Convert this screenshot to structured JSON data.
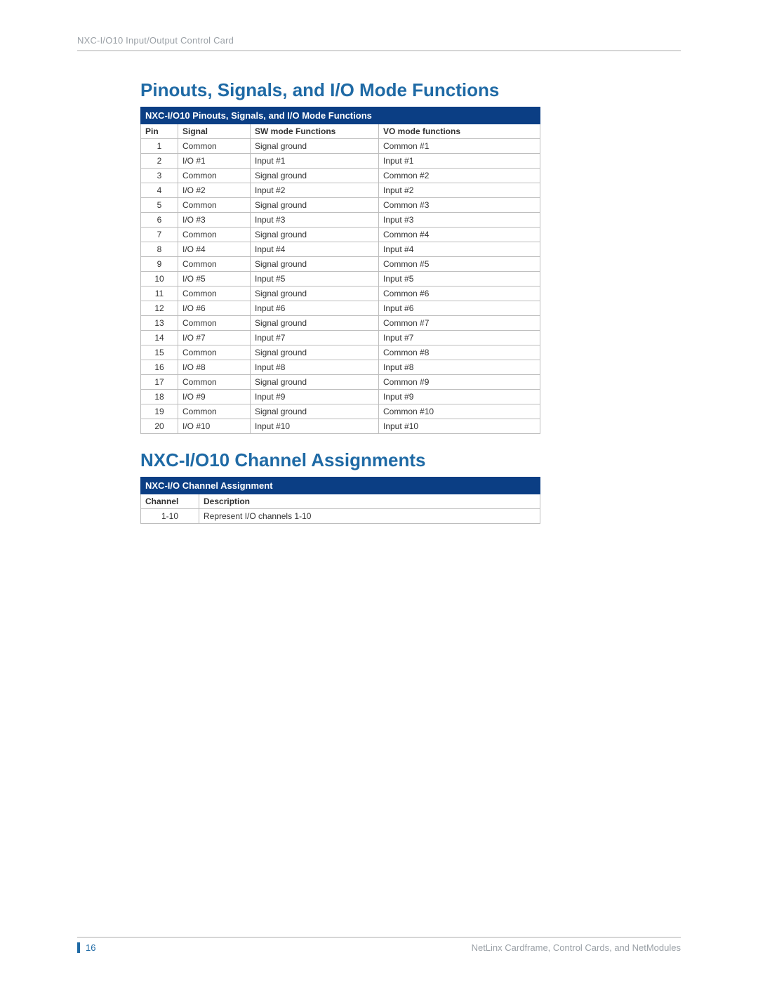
{
  "header": {
    "text": "NXC-I/O10 Input/Output Control Card"
  },
  "section1": {
    "title": "Pinouts, Signals, and I/O Mode Functions",
    "table_title": "NXC-I/O10 Pinouts, Signals, and I/O Mode Functions",
    "columns": {
      "c1": "Pin",
      "c2": "Signal",
      "c3": "SW mode Functions",
      "c4": "VO mode functions"
    },
    "rows": [
      {
        "pin": "1",
        "signal": "Common",
        "sw": "Signal ground",
        "vo": "Common #1"
      },
      {
        "pin": "2",
        "signal": "I/O #1",
        "sw": "Input #1",
        "vo": "Input #1"
      },
      {
        "pin": "3",
        "signal": "Common",
        "sw": "Signal ground",
        "vo": "Common #2"
      },
      {
        "pin": "4",
        "signal": "I/O #2",
        "sw": "Input #2",
        "vo": "Input #2"
      },
      {
        "pin": "5",
        "signal": "Common",
        "sw": "Signal ground",
        "vo": "Common #3"
      },
      {
        "pin": "6",
        "signal": "I/O #3",
        "sw": "Input #3",
        "vo": "Input #3"
      },
      {
        "pin": "7",
        "signal": "Common",
        "sw": "Signal ground",
        "vo": "Common #4"
      },
      {
        "pin": "8",
        "signal": "I/O #4",
        "sw": "Input #4",
        "vo": "Input #4"
      },
      {
        "pin": "9",
        "signal": "Common",
        "sw": "Signal ground",
        "vo": "Common #5"
      },
      {
        "pin": "10",
        "signal": "I/O #5",
        "sw": "Input #5",
        "vo": "Input #5"
      },
      {
        "pin": "11",
        "signal": "Common",
        "sw": "Signal ground",
        "vo": "Common #6"
      },
      {
        "pin": "12",
        "signal": "I/O #6",
        "sw": "Input #6",
        "vo": "Input #6"
      },
      {
        "pin": "13",
        "signal": "Common",
        "sw": "Signal ground",
        "vo": "Common #7"
      },
      {
        "pin": "14",
        "signal": "I/O #7",
        "sw": "Input #7",
        "vo": "Input #7"
      },
      {
        "pin": "15",
        "signal": "Common",
        "sw": "Signal ground",
        "vo": "Common #8"
      },
      {
        "pin": "16",
        "signal": "I/O #8",
        "sw": "Input #8",
        "vo": "Input #8"
      },
      {
        "pin": "17",
        "signal": "Common",
        "sw": "Signal ground",
        "vo": "Common #9"
      },
      {
        "pin": "18",
        "signal": "I/O #9",
        "sw": "Input #9",
        "vo": "Input #9"
      },
      {
        "pin": "19",
        "signal": "Common",
        "sw": "Signal ground",
        "vo": "Common #10"
      },
      {
        "pin": "20",
        "signal": "I/O #10",
        "sw": "Input #10",
        "vo": "Input #10"
      }
    ]
  },
  "section2": {
    "title": "NXC-I/O10 Channel Assignments",
    "table_title": "NXC-I/O Channel Assignment",
    "columns": {
      "c1": "Channel",
      "c2": "Description"
    },
    "rows": [
      {
        "ch": "1-10",
        "desc": "Represent I/O channels 1-10"
      }
    ]
  },
  "footer": {
    "page": "16",
    "right": "NetLinx Cardframe, Control Cards, and NetModules"
  }
}
